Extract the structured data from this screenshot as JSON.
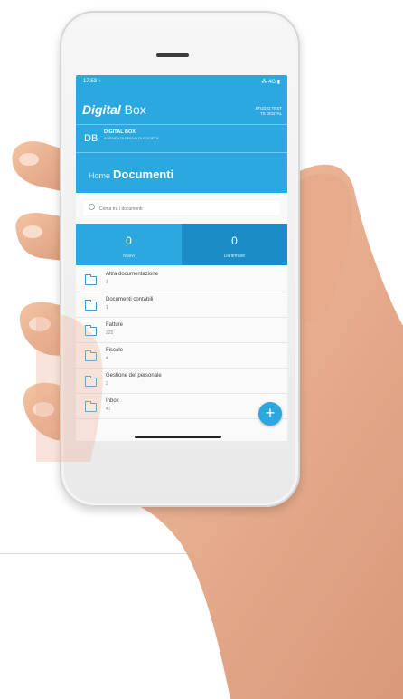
{
  "status_bar": {
    "time": "17:53 ↑",
    "icons": "⁂ 4G ▮"
  },
  "header": {
    "brand_bold": "Digital",
    "brand_rest": " Box",
    "studio_line1": "STUDIO TEST",
    "studio_line2": "TS DIGITAL"
  },
  "company": {
    "badge": "DB",
    "title": "DIGITAL BOX",
    "subtitle": "AZIENDA DI PROVA DI SOCIETÀ"
  },
  "breadcrumb": {
    "home": "Home",
    "current": "Documenti"
  },
  "search": {
    "placeholder": "Cerca tra i documenti"
  },
  "stats": {
    "left": {
      "value": "0",
      "label": "Nuovi"
    },
    "right": {
      "value": "0",
      "label": "Da firmare"
    }
  },
  "folders": [
    {
      "name": "Altra documentazione",
      "count": "1"
    },
    {
      "name": "Documenti contabili",
      "count": "1"
    },
    {
      "name": "Fatture",
      "count": "225"
    },
    {
      "name": "Fiscale",
      "count": "4"
    },
    {
      "name": "Gestione del personale",
      "count": "2"
    },
    {
      "name": "Inbox",
      "count": "47"
    }
  ],
  "fab": {
    "label": "+"
  },
  "colors": {
    "accent": "#2ba8df",
    "accent_dark": "#1b8dc4"
  }
}
